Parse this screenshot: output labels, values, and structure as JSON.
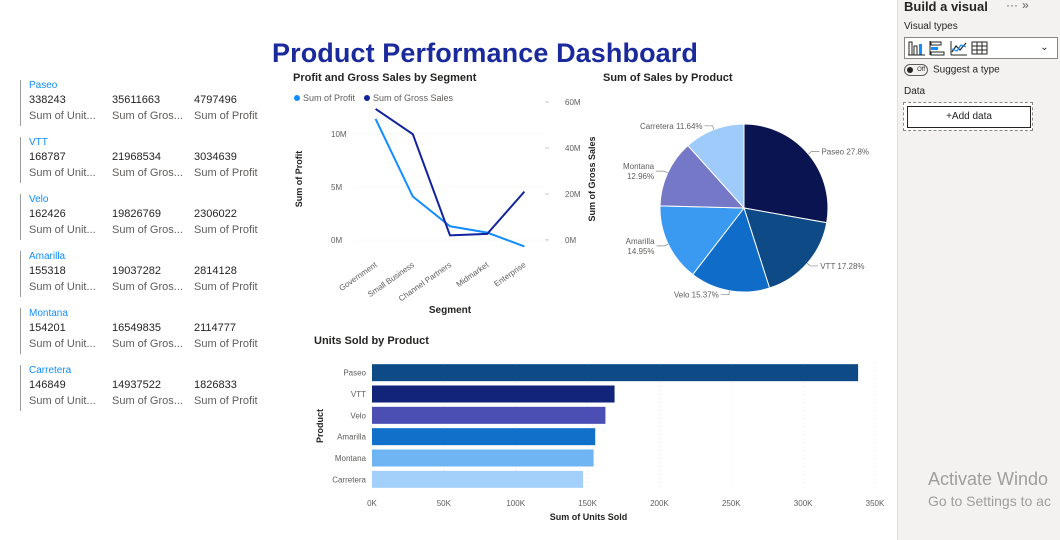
{
  "dashboard": {
    "title": "Product Performance Dashboard"
  },
  "cards": [
    {
      "product": "Paseo",
      "units": "338243",
      "gross": "35611663",
      "profit": "4797496",
      "units_label": "Sum of Unit...",
      "gross_label": "Sum of Gros...",
      "profit_label": "Sum of Profit"
    },
    {
      "product": "VTT",
      "units": "168787",
      "gross": "21968534",
      "profit": "3034639",
      "units_label": "Sum of Unit...",
      "gross_label": "Sum of Gros...",
      "profit_label": "Sum of Profit"
    },
    {
      "product": "Velo",
      "units": "162426",
      "gross": "19826769",
      "profit": "2306022",
      "units_label": "Sum of Unit...",
      "gross_label": "Sum of Gros...",
      "profit_label": "Sum of Profit"
    },
    {
      "product": "Amarilla",
      "units": "155318",
      "gross": "19037282",
      "profit": "2814128",
      "units_label": "Sum of Unit...",
      "gross_label": "Sum of Gros...",
      "profit_label": "Sum of Profit"
    },
    {
      "product": "Montana",
      "units": "154201",
      "gross": "16549835",
      "profit": "2114777",
      "units_label": "Sum of Unit...",
      "gross_label": "Sum of Gros...",
      "profit_label": "Sum of Profit"
    },
    {
      "product": "Carretera",
      "units": "146849",
      "gross": "14937522",
      "profit": "1826833",
      "units_label": "Sum of Unit...",
      "gross_label": "Sum of Gros...",
      "profit_label": "Sum of Profit"
    }
  ],
  "chart_data": [
    {
      "type": "line",
      "title": "Profit and Gross Sales by Segment",
      "xlabel": "Segment",
      "ylabel": "Sum of Profit",
      "y2label": "Sum of Gross Sales",
      "categories": [
        "Government",
        "Small Business",
        "Channel Partners",
        "Midmarket",
        "Enterprise"
      ],
      "series": [
        {
          "name": "Sum of Profit",
          "axis": "left",
          "color": "#118dff",
          "values": [
            11400000,
            4100000,
            1300000,
            700000,
            -600000
          ]
        },
        {
          "name": "Sum of Gross Sales",
          "axis": "right",
          "color": "#12239e",
          "values": [
            57000000,
            46000000,
            2000000,
            2600000,
            21000000
          ]
        }
      ],
      "ylim": [
        -1500000,
        13000000
      ],
      "y2lim": [
        -7000000,
        60000000
      ],
      "yticks": [
        {
          "v": 0,
          "label": "0M"
        },
        {
          "v": 5000000,
          "label": "5M"
        },
        {
          "v": 10000000,
          "label": "10M"
        }
      ],
      "y2ticks": [
        {
          "v": 0,
          "label": "0M"
        },
        {
          "v": 20000000,
          "label": "20M"
        },
        {
          "v": 40000000,
          "label": "40M"
        },
        {
          "v": 60000000,
          "label": "60M"
        }
      ],
      "legend": "top-left"
    },
    {
      "type": "pie",
      "title": "Sum of Sales by Product",
      "slices": [
        {
          "label": "Paseo 27.8%",
          "value": 27.8,
          "color": "#0a1451"
        },
        {
          "label": "VTT 17.28%",
          "value": 17.28,
          "color": "#0d4a86"
        },
        {
          "label": "Velo 15.37%",
          "value": 15.37,
          "color": "#0f6cc8"
        },
        {
          "label": "Amarilla 14.95%",
          "value": 14.95,
          "color": "#3a9af2"
        },
        {
          "label": "Montana 12.96%",
          "value": 12.96,
          "color": "#7478c6"
        },
        {
          "label": "Carretera 11.64%",
          "value": 11.64,
          "color": "#9ecbfa"
        }
      ]
    },
    {
      "type": "bar",
      "orientation": "horizontal",
      "title": "Units Sold by Product",
      "xlabel": "Sum of Units Sold",
      "ylabel": "Product",
      "categories": [
        "Paseo",
        "VTT",
        "Velo",
        "Amarilla",
        "Montana",
        "Carretera"
      ],
      "values": [
        338243,
        168787,
        162426,
        155318,
        154201,
        146849
      ],
      "colors": [
        "#0d4a86",
        "#12237a",
        "#4b4fb3",
        "#1170c9",
        "#6fb5f3",
        "#a3d0fa"
      ],
      "xlim": [
        0,
        350000
      ],
      "xticks": [
        {
          "v": 0,
          "label": "0K"
        },
        {
          "v": 50000,
          "label": "50K"
        },
        {
          "v": 100000,
          "label": "100K"
        },
        {
          "v": 150000,
          "label": "150K"
        },
        {
          "v": 200000,
          "label": "200K"
        },
        {
          "v": 250000,
          "label": "250K"
        },
        {
          "v": 300000,
          "label": "300K"
        },
        {
          "v": 350000,
          "label": "350K"
        }
      ]
    }
  ],
  "panel": {
    "title": "Build a visual",
    "more_icon": "ellipsis-icon",
    "collapse_icon": "double-chevron-right-icon",
    "visual_types_label": "Visual types",
    "suggest_label": "Suggest a type",
    "toggle_state": "Off",
    "data_label": "Data",
    "add_data_label": "+Add data"
  },
  "watermark": {
    "line1": "Activate Windo",
    "line2": "Go to Settings to ac"
  }
}
